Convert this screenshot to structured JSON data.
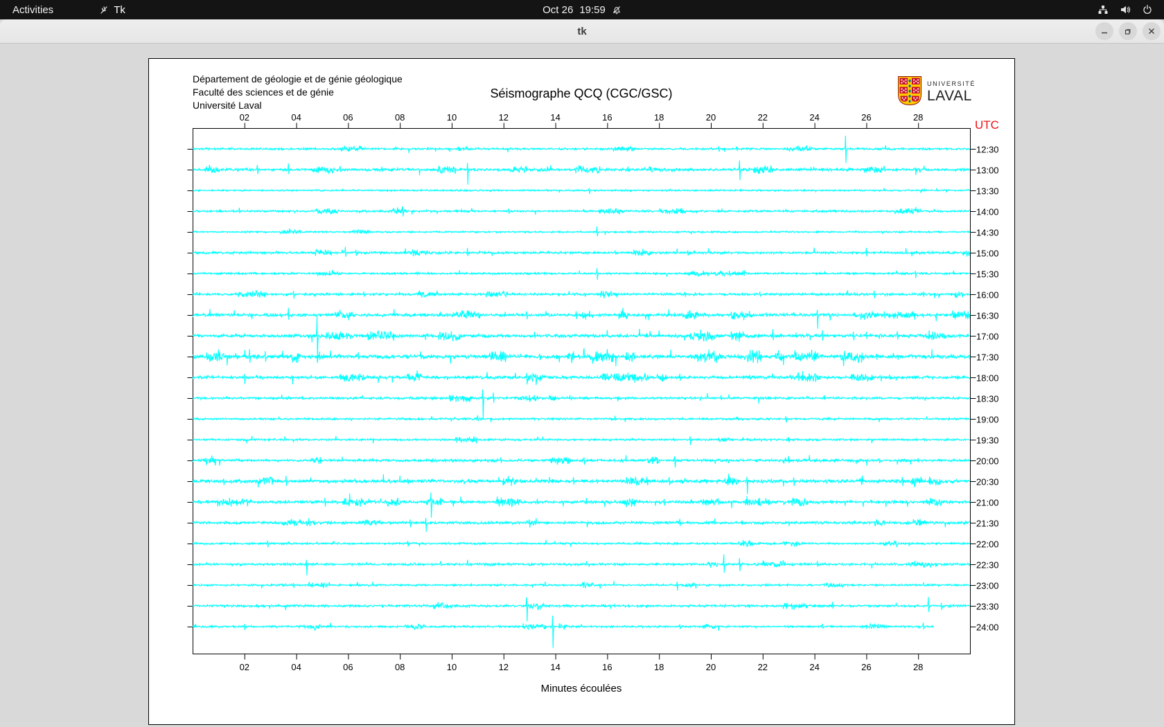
{
  "topbar": {
    "activities_label": "Activities",
    "app_label": "Tk",
    "clock_date": "Oct 26",
    "clock_time": "19:59"
  },
  "titlebar": {
    "title": "tk"
  },
  "header": {
    "line1": "Département de géologie et de génie géologique",
    "line2": "Faculté des sciences et de génie",
    "line3": "Université Laval"
  },
  "logo": {
    "top": "UNIVERSITÉ",
    "bottom": "LAVAL"
  },
  "colors": {
    "trace": "#00ffff",
    "utc_label": "#ee1111",
    "axis": "#000000",
    "topbar_bg": "#141414",
    "window_bg": "#d9d9d9",
    "canvas_bg": "#ffffff"
  },
  "chart_data": {
    "type": "seismogram",
    "title": "Séismographe QCQ (CGC/GSC)",
    "xlabel": "Minutes écoulées",
    "right_axis_title": "UTC",
    "x_range_minutes": [
      0,
      30
    ],
    "x_ticks": [
      "02",
      "04",
      "06",
      "08",
      "10",
      "12",
      "14",
      "16",
      "18",
      "20",
      "22",
      "24",
      "26",
      "28"
    ],
    "row_spacing_px": 30,
    "seed": 20241026,
    "rows": [
      {
        "time": "12:30",
        "activity": 2,
        "spikes": [
          [
            20.3,
            4,
            4
          ],
          [
            21.0,
            3,
            3
          ],
          [
            25.2,
            18,
            20
          ]
        ]
      },
      {
        "time": "13:00",
        "activity": 4,
        "spikes": [
          [
            2.5,
            6,
            5
          ],
          [
            3.7,
            8,
            7
          ],
          [
            5.7,
            5,
            4
          ],
          [
            7.3,
            4,
            3
          ],
          [
            10.6,
            8,
            20
          ],
          [
            13.7,
            5,
            4
          ],
          [
            16.8,
            4,
            4
          ],
          [
            21.1,
            14,
            12
          ],
          [
            22.0,
            5,
            4
          ],
          [
            27.9,
            4,
            7
          ]
        ]
      },
      {
        "time": "13:30",
        "activity": 1,
        "spikes": [
          [
            15.3,
            3,
            4
          ]
        ]
      },
      {
        "time": "14:00",
        "activity": 2,
        "spikes": [
          [
            1.8,
            4,
            3
          ],
          [
            8.1,
            6,
            9
          ],
          [
            12.2,
            3,
            3
          ]
        ]
      },
      {
        "time": "14:30",
        "activity": 1,
        "spikes": [
          [
            15.6,
            8,
            7
          ]
        ]
      },
      {
        "time": "15:00",
        "activity": 3,
        "spikes": [
          [
            5.9,
            7,
            6
          ],
          [
            6.3,
            5,
            5
          ],
          [
            10.6,
            6,
            5
          ],
          [
            16.3,
            4,
            3
          ],
          [
            19.1,
            3,
            4
          ],
          [
            26.0,
            6,
            5
          ]
        ]
      },
      {
        "time": "15:30",
        "activity": 2,
        "spikes": [
          [
            15.6,
            7,
            9
          ],
          [
            27.9,
            5,
            6
          ]
        ]
      },
      {
        "time": "16:00",
        "activity": 3,
        "spikes": [
          [
            3.9,
            5,
            7
          ],
          [
            6.6,
            4,
            3
          ],
          [
            19.0,
            4,
            3
          ],
          [
            21.9,
            3,
            3
          ],
          [
            26.3,
            5,
            6
          ],
          [
            28.2,
            4,
            4
          ]
        ]
      },
      {
        "time": "16:30",
        "activity": 5,
        "spikes": [
          [
            3.7,
            9,
            8
          ],
          [
            12.9,
            6,
            6
          ],
          [
            14.8,
            5,
            5
          ],
          [
            16.6,
            5,
            4
          ],
          [
            18.6,
            4,
            3
          ],
          [
            24.1,
            8,
            20
          ],
          [
            26.7,
            4,
            4
          ]
        ]
      },
      {
        "time": "17:00",
        "activity": 6,
        "spikes": [
          [
            4.8,
            28,
            35
          ],
          [
            13.2,
            5,
            4
          ],
          [
            22.4,
            8,
            7
          ],
          [
            24.3,
            7,
            6
          ],
          [
            25.5,
            6,
            8
          ],
          [
            26.0,
            5,
            5
          ],
          [
            27.2,
            6,
            5
          ],
          [
            28.3,
            5,
            4
          ]
        ]
      },
      {
        "time": "17:30",
        "activity": 8,
        "spikes": [
          [
            1.0,
            8,
            7
          ],
          [
            2.2,
            10,
            9
          ],
          [
            2.8,
            8,
            7
          ],
          [
            4.9,
            7,
            6
          ],
          [
            6.4,
            6,
            5
          ],
          [
            8.8,
            7,
            6
          ],
          [
            11.9,
            8,
            7
          ],
          [
            13.4,
            6,
            5
          ],
          [
            15.6,
            5,
            5
          ],
          [
            19.6,
            6,
            5
          ],
          [
            21.6,
            7,
            6
          ],
          [
            22.6,
            6,
            5
          ],
          [
            23.9,
            7,
            6
          ],
          [
            25.1,
            6,
            6
          ],
          [
            26.4,
            5,
            5
          ]
        ]
      },
      {
        "time": "18:00",
        "activity": 5,
        "spikes": [
          [
            2.0,
            5,
            9
          ],
          [
            5.7,
            6,
            5
          ],
          [
            12.9,
            7,
            10
          ],
          [
            16.8,
            6,
            5
          ],
          [
            18.8,
            4,
            4
          ],
          [
            21.5,
            5,
            4
          ],
          [
            24.1,
            5,
            4
          ],
          [
            26.9,
            4,
            4
          ]
        ]
      },
      {
        "time": "18:30",
        "activity": 3,
        "spikes": [
          [
            11.2,
            14,
            30
          ],
          [
            11.6,
            7,
            6
          ],
          [
            13.0,
            4,
            4
          ],
          [
            20.4,
            3,
            3
          ]
        ]
      },
      {
        "time": "19:00",
        "activity": 2,
        "spikes": [
          [
            11.0,
            4,
            4
          ],
          [
            16.3,
            4,
            3
          ],
          [
            22.9,
            4,
            6
          ]
        ]
      },
      {
        "time": "19:30",
        "activity": 2,
        "spikes": [
          [
            19.2,
            5,
            8
          ],
          [
            23.0,
            4,
            4
          ]
        ]
      },
      {
        "time": "20:00",
        "activity": 4,
        "spikes": [
          [
            11.9,
            5,
            4
          ],
          [
            15.1,
            6,
            5
          ],
          [
            18.6,
            6,
            10
          ],
          [
            23.0,
            5,
            4
          ],
          [
            26.5,
            4,
            4
          ],
          [
            28.0,
            3,
            3
          ]
        ]
      },
      {
        "time": "20:30",
        "activity": 6,
        "spikes": [
          [
            1.2,
            6,
            5
          ],
          [
            3.6,
            7,
            6
          ],
          [
            8.3,
            5,
            4
          ],
          [
            14.7,
            5,
            4
          ],
          [
            18.4,
            5,
            5
          ],
          [
            21.4,
            8,
            18
          ],
          [
            23.2,
            6,
            5
          ],
          [
            25.8,
            5,
            5
          ],
          [
            27.4,
            6,
            6
          ],
          [
            28.6,
            5,
            4
          ]
        ]
      },
      {
        "time": "21:00",
        "activity": 5,
        "spikes": [
          [
            1.7,
            5,
            8
          ],
          [
            5.1,
            6,
            5
          ],
          [
            9.2,
            12,
            26
          ],
          [
            12.2,
            5,
            5
          ],
          [
            13.3,
            4,
            4
          ],
          [
            15.2,
            5,
            4
          ],
          [
            18.2,
            4,
            4
          ],
          [
            21.4,
            6,
            5
          ]
        ]
      },
      {
        "time": "21:30",
        "activity": 4,
        "spikes": [
          [
            8.4,
            5,
            5
          ],
          [
            9.0,
            7,
            14
          ],
          [
            13.0,
            4,
            4
          ],
          [
            18.8,
            5,
            4
          ],
          [
            21.2,
            4,
            4
          ],
          [
            23.0,
            3,
            3
          ]
        ]
      },
      {
        "time": "22:00",
        "activity": 2,
        "spikes": [
          [
            2.9,
            4,
            6
          ],
          [
            8.3,
            4,
            4
          ]
        ]
      },
      {
        "time": "22:30",
        "activity": 3,
        "spikes": [
          [
            4.4,
            6,
            16
          ],
          [
            20.5,
            14,
            12
          ],
          [
            21.1,
            10,
            9
          ],
          [
            24.1,
            4,
            3
          ]
        ]
      },
      {
        "time": "23:00",
        "activity": 2,
        "spikes": [
          [
            3.9,
            4,
            4
          ],
          [
            18.7,
            5,
            8
          ]
        ]
      },
      {
        "time": "23:30",
        "activity": 3,
        "spikes": [
          [
            12.9,
            10,
            22
          ],
          [
            24.7,
            5,
            4
          ],
          [
            28.4,
            12,
            10
          ],
          [
            28.9,
            5,
            5
          ]
        ]
      },
      {
        "time": "24:00",
        "activity": 2,
        "end_min": 28.6,
        "spikes": [
          [
            2.0,
            3,
            4
          ],
          [
            13.9,
            16,
            30
          ],
          [
            18.8,
            4,
            4
          ],
          [
            24.3,
            4,
            3
          ],
          [
            28.2,
            6,
            5
          ]
        ]
      }
    ]
  }
}
